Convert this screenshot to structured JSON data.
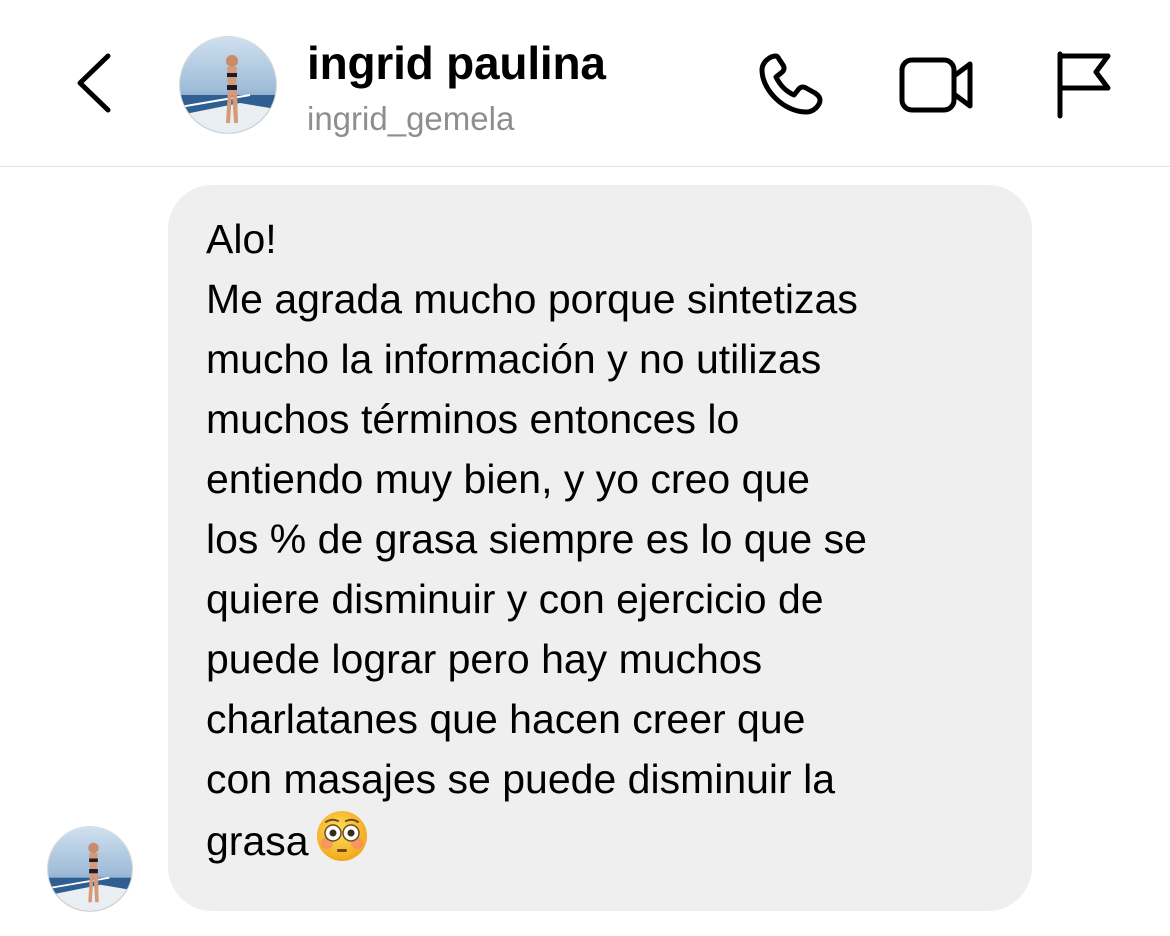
{
  "header": {
    "back_icon": "chevron-left-icon",
    "name": "ingrid paulina",
    "username": "ingrid_gemela",
    "avatar_icon": "profile-photo",
    "actions": [
      {
        "icon": "phone-icon"
      },
      {
        "icon": "video-camera-icon"
      },
      {
        "icon": "flag-icon"
      }
    ]
  },
  "message": {
    "greeting": "Alo!",
    "body": "Me agrada mucho porque sintetizas\nmucho la información y no utilizas\nmuchos términos entonces lo\nentiendo muy bien, y yo creo que\nlos % de grasa siempre es lo que se\nquiere disminuir y con ejercicio de\npuede lograr pero hay muchos\ncharlatanes que hacen creer que\ncon masajes se puede disminuir la\ngrasa",
    "emoji": "flushed-face-emoji",
    "bubble_color": "#efefef"
  },
  "colors": {
    "secondary_text": "#8e8e8e",
    "divider": "#e3e3e3"
  }
}
